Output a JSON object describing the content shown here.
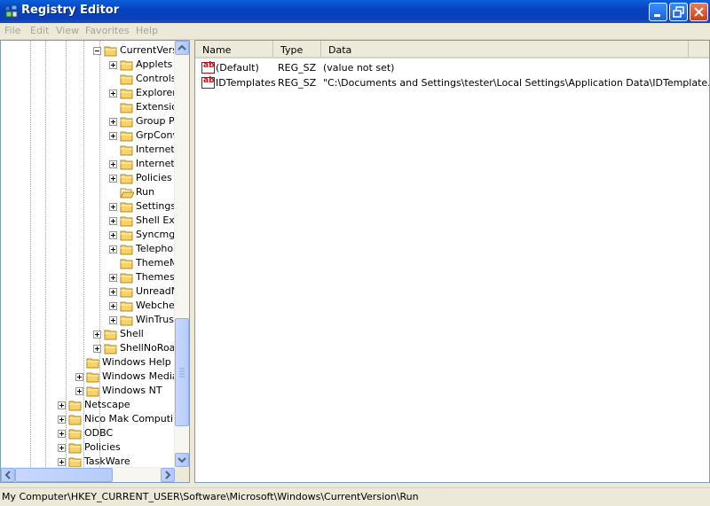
{
  "window": {
    "title": "Registry Editor"
  },
  "menu": [
    "File",
    "Edit",
    "View",
    "Favorites",
    "Help"
  ],
  "tree": [
    {
      "label": "CurrentVers",
      "level": 4,
      "expander": "minus",
      "open": false
    },
    {
      "label": "Applets",
      "level": 5,
      "expander": "plus"
    },
    {
      "label": "Controls",
      "level": 5,
      "expander": "none"
    },
    {
      "label": "Explorer",
      "level": 5,
      "expander": "plus"
    },
    {
      "label": "Extensio",
      "level": 5,
      "expander": "none"
    },
    {
      "label": "Group P",
      "level": 5,
      "expander": "plus"
    },
    {
      "label": "GrpConv",
      "level": 5,
      "expander": "plus"
    },
    {
      "label": "Internet",
      "level": 5,
      "expander": "none"
    },
    {
      "label": "Internet",
      "level": 5,
      "expander": "plus"
    },
    {
      "label": "Policies",
      "level": 5,
      "expander": "plus"
    },
    {
      "label": "Run",
      "level": 5,
      "expander": "none",
      "open": true
    },
    {
      "label": "Settings",
      "level": 5,
      "expander": "plus"
    },
    {
      "label": "Shell Ex",
      "level": 5,
      "expander": "plus"
    },
    {
      "label": "Syncmgr",
      "level": 5,
      "expander": "plus"
    },
    {
      "label": "Telepho",
      "level": 5,
      "expander": "plus"
    },
    {
      "label": "ThemeM",
      "level": 5,
      "expander": "none"
    },
    {
      "label": "Themes",
      "level": 5,
      "expander": "plus"
    },
    {
      "label": "UnreadM",
      "level": 5,
      "expander": "plus"
    },
    {
      "label": "Webche",
      "level": 5,
      "expander": "plus"
    },
    {
      "label": "WinTrus",
      "level": 5,
      "expander": "plus"
    },
    {
      "label": "Shell",
      "level": 4,
      "expander": "plus"
    },
    {
      "label": "ShellNoRoar",
      "level": 4,
      "expander": "plus"
    },
    {
      "label": "Windows Help",
      "level": 3,
      "expander": "none"
    },
    {
      "label": "Windows Media",
      "level": 3,
      "expander": "plus"
    },
    {
      "label": "Windows NT",
      "level": 3,
      "expander": "plus"
    },
    {
      "label": "Netscape",
      "level": 2,
      "expander": "plus"
    },
    {
      "label": "Nico Mak Computing",
      "level": 2,
      "expander": "plus"
    },
    {
      "label": "ODBC",
      "level": 2,
      "expander": "plus"
    },
    {
      "label": "Policies",
      "level": 2,
      "expander": "plus"
    },
    {
      "label": "TaskWare",
      "level": 2,
      "expander": "plus"
    }
  ],
  "list": {
    "columns": [
      "Name",
      "Type",
      "Data"
    ],
    "rows": [
      {
        "name": "(Default)",
        "type": "REG_SZ",
        "data": "(value not set)"
      },
      {
        "name": "IDTemplates",
        "type": "REG_SZ",
        "data": "\"C:\\Documents and Settings\\tester\\Local Settings\\Application Data\\IDTemplate.exe\""
      }
    ]
  },
  "status": {
    "path": "My Computer\\HKEY_CURRENT_USER\\Software\\Microsoft\\Windows\\CurrentVersion\\Run"
  },
  "colors": {
    "titlebar": "#0842c2",
    "folder": "#f3d36a",
    "folder_edge": "#b08a1f"
  }
}
